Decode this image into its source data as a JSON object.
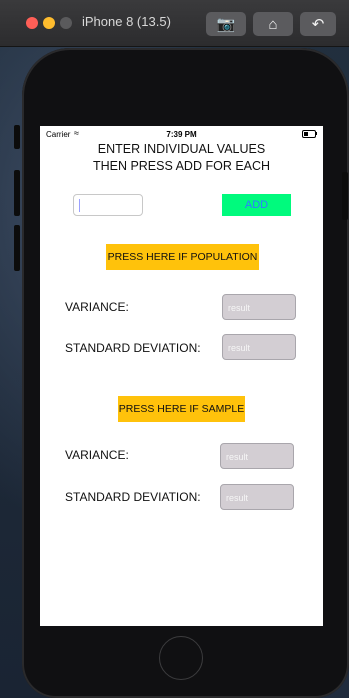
{
  "window": {
    "title": "iPhone 8 (13.5)",
    "toolbar_icons": [
      "screenshot-icon",
      "home-icon",
      "rotate-icon"
    ]
  },
  "statusbar": {
    "carrier": "Carrier",
    "time": "7:39 PM"
  },
  "app": {
    "instructions_line1": "ENTER INDIVIDUAL VALUES",
    "instructions_line2": "THEN PRESS ADD FOR EACH",
    "input_value": "",
    "add_label": "ADD",
    "population": {
      "button_label": "PRESS HERE IF POPULATION",
      "variance_label": "VARIANCE:",
      "variance_placeholder": "result",
      "stddev_label": "STANDARD DEVIATION:",
      "stddev_placeholder": "result"
    },
    "sample": {
      "button_label": "PRESS HERE IF SAMPLE",
      "variance_label": "VARIANCE:",
      "variance_placeholder": "result",
      "stddev_label": "STANDARD DEVIATION:",
      "stddev_placeholder": "result"
    }
  },
  "colors": {
    "add_button": "#00fa7d",
    "add_text": "#2f7bff",
    "yellow_button": "#ffc20b",
    "result_field": "#d3ced3"
  }
}
